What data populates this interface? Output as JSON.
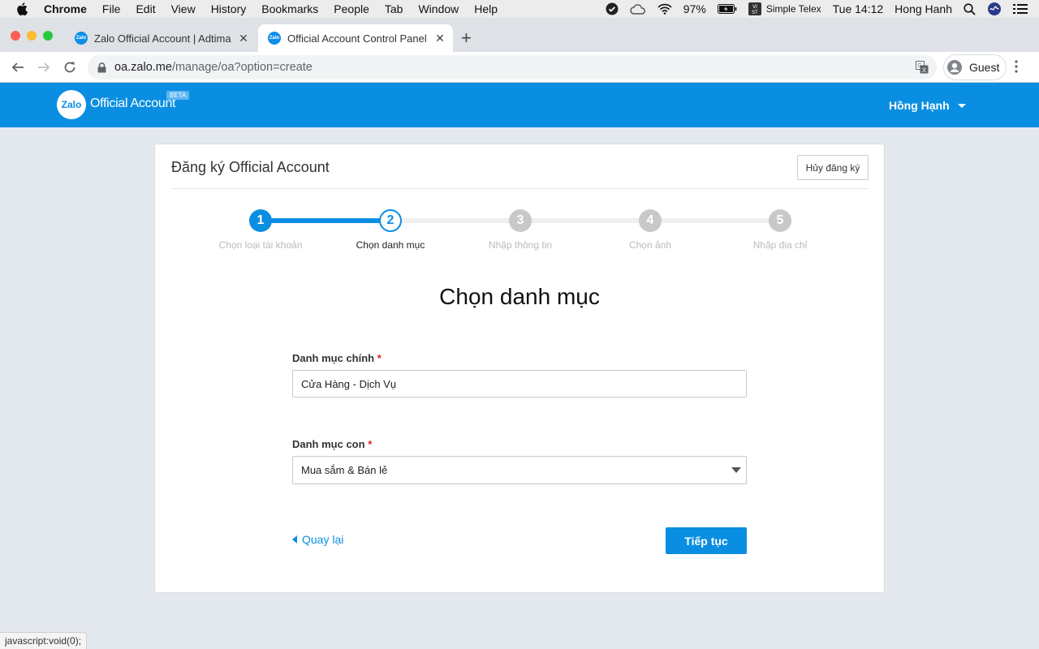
{
  "menubar": {
    "items": [
      "Chrome",
      "File",
      "Edit",
      "View",
      "History",
      "Bookmarks",
      "People",
      "Tab",
      "Window",
      "Help"
    ],
    "battery": "97%",
    "input_method": "Simple Telex",
    "clock": "Tue 14:12",
    "user": "Hong Hanh"
  },
  "tabs": [
    {
      "title": "Zalo Official Account | Adtima",
      "favicon": "Zalo"
    },
    {
      "title": "Official Account Control Panel",
      "favicon": "Zalo"
    }
  ],
  "address": {
    "host": "oa.zalo.me",
    "path": "/manage/oa?option=create"
  },
  "profile": {
    "label": "Guest"
  },
  "header": {
    "logo": "Zalo",
    "brand": "Official Account",
    "badge": "BETA",
    "user": "Hồng Hạnh"
  },
  "card": {
    "title": "Đăng ký Official Account",
    "cancel_label": "Hủy đăng ký",
    "steps": [
      {
        "number": "1",
        "label": "Chọn loại tài khoản",
        "state": "done"
      },
      {
        "number": "2",
        "label": "Chọn danh mục",
        "state": "current"
      },
      {
        "number": "3",
        "label": "Nhập thông tin",
        "state": "todo"
      },
      {
        "number": "4",
        "label": "Chọn ảnh",
        "state": "todo"
      },
      {
        "number": "5",
        "label": "Nhập địa chỉ",
        "state": "todo"
      }
    ],
    "heading": "Chọn danh mục",
    "main_category": {
      "label": "Danh mục chính",
      "required": "*",
      "value": "Cửa Hàng - Dịch Vụ"
    },
    "sub_category": {
      "label": "Danh mục con",
      "required": "*",
      "value": "Mua sắm & Bán lẻ"
    },
    "back_label": "Quay lại",
    "next_label": "Tiếp tục"
  },
  "status_text": "javascript:void(0);",
  "colors": {
    "brand": "#0a8ee1",
    "required": "#e02020"
  }
}
